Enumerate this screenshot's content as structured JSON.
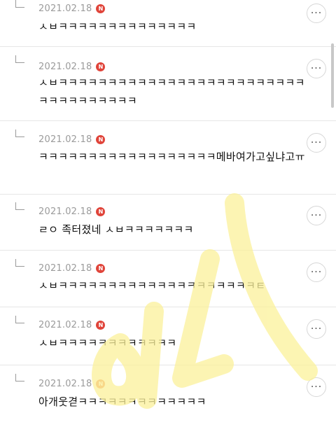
{
  "comments": [
    {
      "date": "2021.02.18",
      "badge": "N",
      "text": "ㅅㅂㅋㅋㅋㅋㅋㅋㅋㅋㅋㅋㅋㅋㅋㅋ",
      "more": "···"
    },
    {
      "date": "2021.02.18",
      "badge": "N",
      "text": "ㅅㅂㅋㅋㅋㅋㅋㅋㅋㅋㅋㅋㅋㅋㅋㅋㅋㅋㅋㅋㅋㅋㅋㅋㅋㅋㅋㅋㅋㅋㅋㅋㅋㅋㅋㅋㅋ",
      "more": "···"
    },
    {
      "date": "2021.02.18",
      "badge": "N",
      "text": "ㅋㅋㅋㅋㅋㅋㅋㅋㅋㅋㅋㅋㅋㅋㅋㅋㅋㅋ메바여가고싶냐고ㅠ",
      "more": "···"
    },
    {
      "date": "2021.02.18",
      "badge": "N",
      "text": "ㄹㅇ 족터졌네 ㅅㅂㅋㅋㅋㅋㅋㅋㅋ",
      "more": "···"
    },
    {
      "date": "2021.02.18",
      "badge": "N",
      "text": "ㅅㅂㅋㅋㅋㅋㅋㅋㅋㅋㅋㅋㅋㅋㅋㅋㅋㅋㅋㅋㅋㅋㅌ",
      "more": "···"
    },
    {
      "date": "2021.02.18",
      "badge": "N",
      "text": "ㅅㅂㅋㅋㅋㅋㅋㅋㅋㅋㅋㅋㅋㅋ",
      "more": "···"
    },
    {
      "date": "2021.02.18",
      "badge": "N",
      "text": "아개웃겯ㅋㅋㅋㅋㅋㅋㅋㅋㅋㅋㅋㅋㅋ",
      "more": "···"
    }
  ],
  "colors": {
    "badge": "#e0443a",
    "badge_alt": "#ef8a52",
    "watermark": "#fbf3a0"
  }
}
